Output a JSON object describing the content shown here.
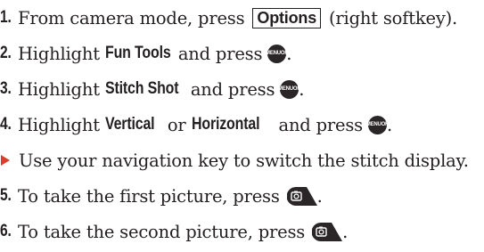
{
  "steps": [
    {
      "num": "1.",
      "pre": "From camera mode, press",
      "key": "Options",
      "post": "(right softkey)."
    },
    {
      "num": "2.",
      "pre": "Highlight",
      "bold": "Fun Tools",
      "post": "and press"
    },
    {
      "num": "3.",
      "pre": "Highlight",
      "bold": "Stitch Shot",
      "post": "and press"
    },
    {
      "num": "4.",
      "pre": "Highlight",
      "bold": "Vertical",
      "mid": "or",
      "bold2": "Horizontal",
      "post": "and press"
    },
    {
      "note": "Use your navigation key to switch the stitch display."
    },
    {
      "num": "5.",
      "pre": "To take the first picture, press"
    },
    {
      "num": "6.",
      "pre": "To take the second picture, press"
    }
  ],
  "keys": {
    "menu_top": "MENU",
    "menu_bottom": "OK"
  },
  "icons": {
    "menu": "menu-ok-key-icon",
    "camera": "camera-key-icon",
    "bullet": "red-arrow-bullet-icon"
  },
  "colors": {
    "text": "#231f20",
    "bullet": "#e03a2f"
  }
}
